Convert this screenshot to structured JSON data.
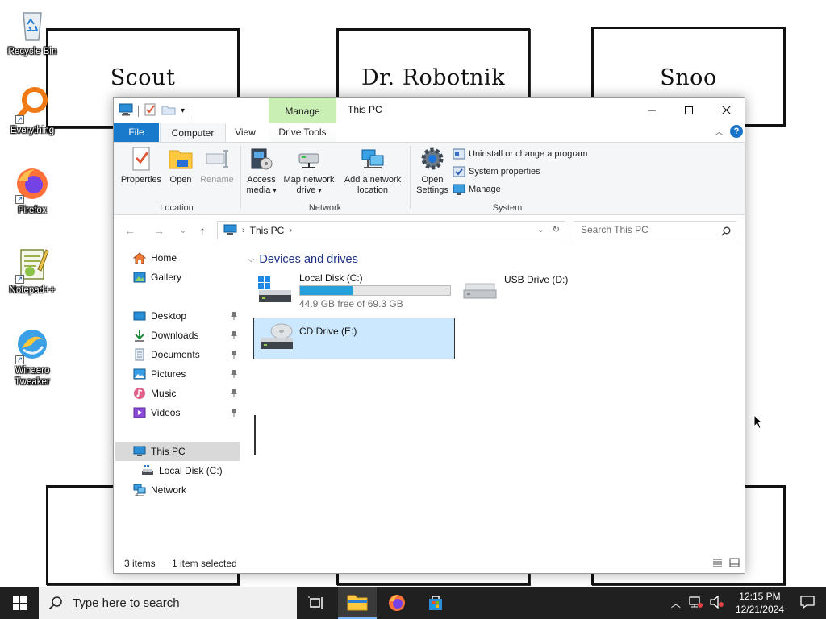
{
  "wallpaper": {
    "frames": [
      "Scout",
      "Dr. Robotnik",
      "Snoo"
    ]
  },
  "desktop": {
    "icons": [
      {
        "label": "Recycle Bin",
        "icon": "recycle-bin-icon"
      },
      {
        "label": "Everything",
        "icon": "everything-search-icon"
      },
      {
        "label": "Firefox",
        "icon": "firefox-icon"
      },
      {
        "label": "Notepad++",
        "icon": "notepad-plus-plus-icon"
      },
      {
        "label": "Winaero Tweaker",
        "icon": "winaero-tweaker-icon"
      }
    ]
  },
  "window": {
    "title": "This PC",
    "context_tab": "Manage",
    "tabs": {
      "file": "File",
      "computer": "Computer",
      "view": "View",
      "drive_tools": "Drive Tools"
    },
    "ribbon": {
      "location": {
        "label": "Location",
        "properties": "Properties",
        "open": "Open",
        "rename": "Rename"
      },
      "network": {
        "label": "Network",
        "access_media": "Access media",
        "map_drive": "Map network drive",
        "add_location": "Add a network location"
      },
      "system": {
        "label": "System",
        "open_settings": "Open Settings",
        "uninstall": "Uninstall or change a program",
        "system_properties": "System properties",
        "manage": "Manage"
      }
    },
    "address": {
      "path": "This PC",
      "search_placeholder": "Search This PC"
    },
    "nav": {
      "home": "Home",
      "gallery": "Gallery",
      "desktop": "Desktop",
      "downloads": "Downloads",
      "documents": "Documents",
      "pictures": "Pictures",
      "music": "Music",
      "videos": "Videos",
      "this_pc": "This PC",
      "local_disk": "Local Disk (C:)",
      "network": "Network"
    },
    "content": {
      "group_title": "Devices and drives",
      "drives": [
        {
          "name": "Local Disk (C:)",
          "free": "44.9 GB free of 69.3 GB",
          "used_fraction": 0.35
        },
        {
          "name": "USB Drive (D:)"
        },
        {
          "name": "CD Drive (E:)"
        }
      ]
    },
    "status": {
      "items": "3 items",
      "selected": "1 item selected"
    }
  },
  "taskbar": {
    "search_placeholder": "Type here to search",
    "time": "12:15 PM",
    "date": "12/21/2024"
  },
  "colors": {
    "accent": "#1979ca",
    "manage_tab": "#c9efb4",
    "selection": "#cce8ff",
    "drive_bar": "#26a0da",
    "taskbar": "#202020"
  }
}
